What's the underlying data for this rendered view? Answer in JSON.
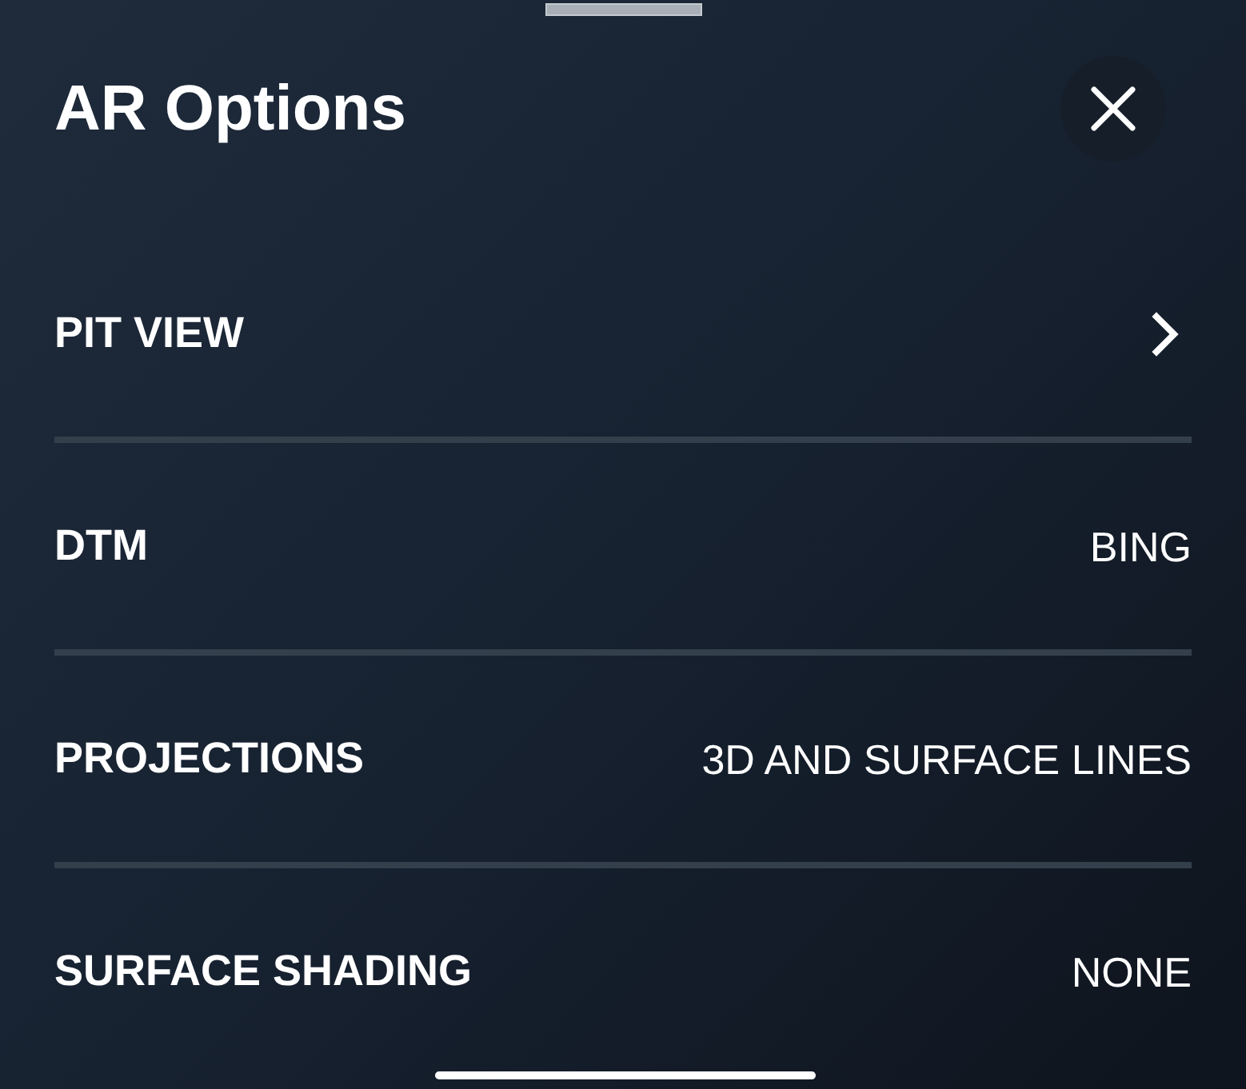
{
  "sheet": {
    "title": "AR Options"
  },
  "options": [
    {
      "label": "PIT VIEW",
      "kind": "link"
    },
    {
      "label": "DTM",
      "kind": "value",
      "value": "BING"
    },
    {
      "label": "PROJECTIONS",
      "kind": "value",
      "value": "3D AND SURFACE LINES"
    },
    {
      "label": "SURFACE SHADING",
      "kind": "value",
      "value": "NONE"
    }
  ]
}
